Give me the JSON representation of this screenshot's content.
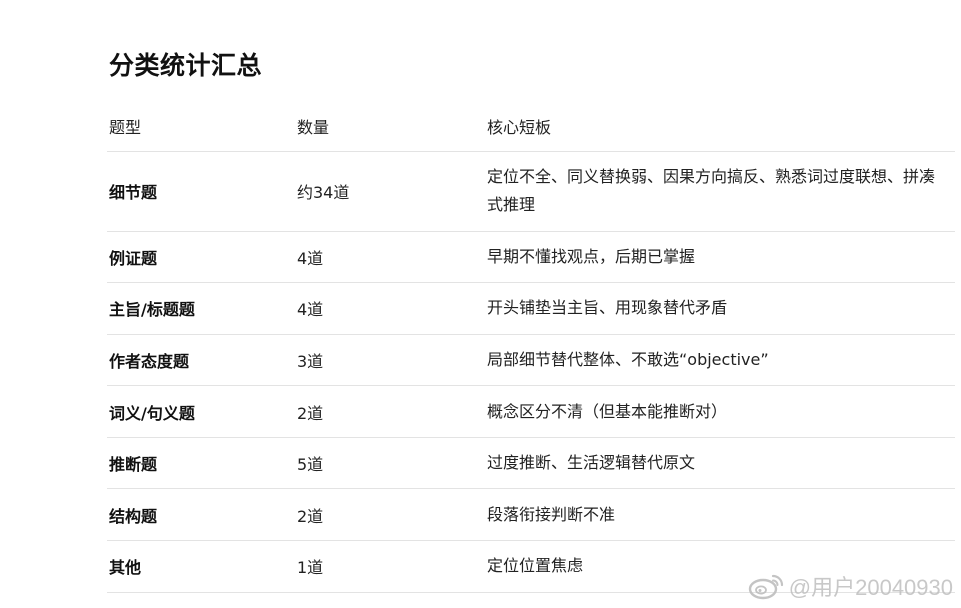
{
  "title": "分类统计汇总",
  "table": {
    "headers": [
      "题型",
      "数量",
      "核心短板"
    ],
    "rows": [
      {
        "type": "细节题",
        "count": "约34道",
        "weakness": "定位不全、同义替换弱、因果方向搞反、熟悉词过度联想、拼凑式推理"
      },
      {
        "type": "例证题",
        "count": "4道",
        "weakness": "早期不懂找观点，后期已掌握"
      },
      {
        "type": "主旨/标题题",
        "count": "4道",
        "weakness": "开头铺垫当主旨、用现象替代矛盾"
      },
      {
        "type": "作者态度题",
        "count": "3道",
        "weakness": "局部细节替代整体、不敢选“objective”"
      },
      {
        "type": "词义/句义题",
        "count": "2道",
        "weakness": "概念区分不清（但基本能推断对）"
      },
      {
        "type": "推断题",
        "count": "5道",
        "weakness": "过度推断、生活逻辑替代原文"
      },
      {
        "type": "结构题",
        "count": "2道",
        "weakness": "段落衔接判断不准"
      },
      {
        "type": "其他",
        "count": "1道",
        "weakness": "定位位置焦虑"
      }
    ]
  },
  "watermark": {
    "text": "@用户20040930",
    "icon": "weibo-logo-icon"
  }
}
